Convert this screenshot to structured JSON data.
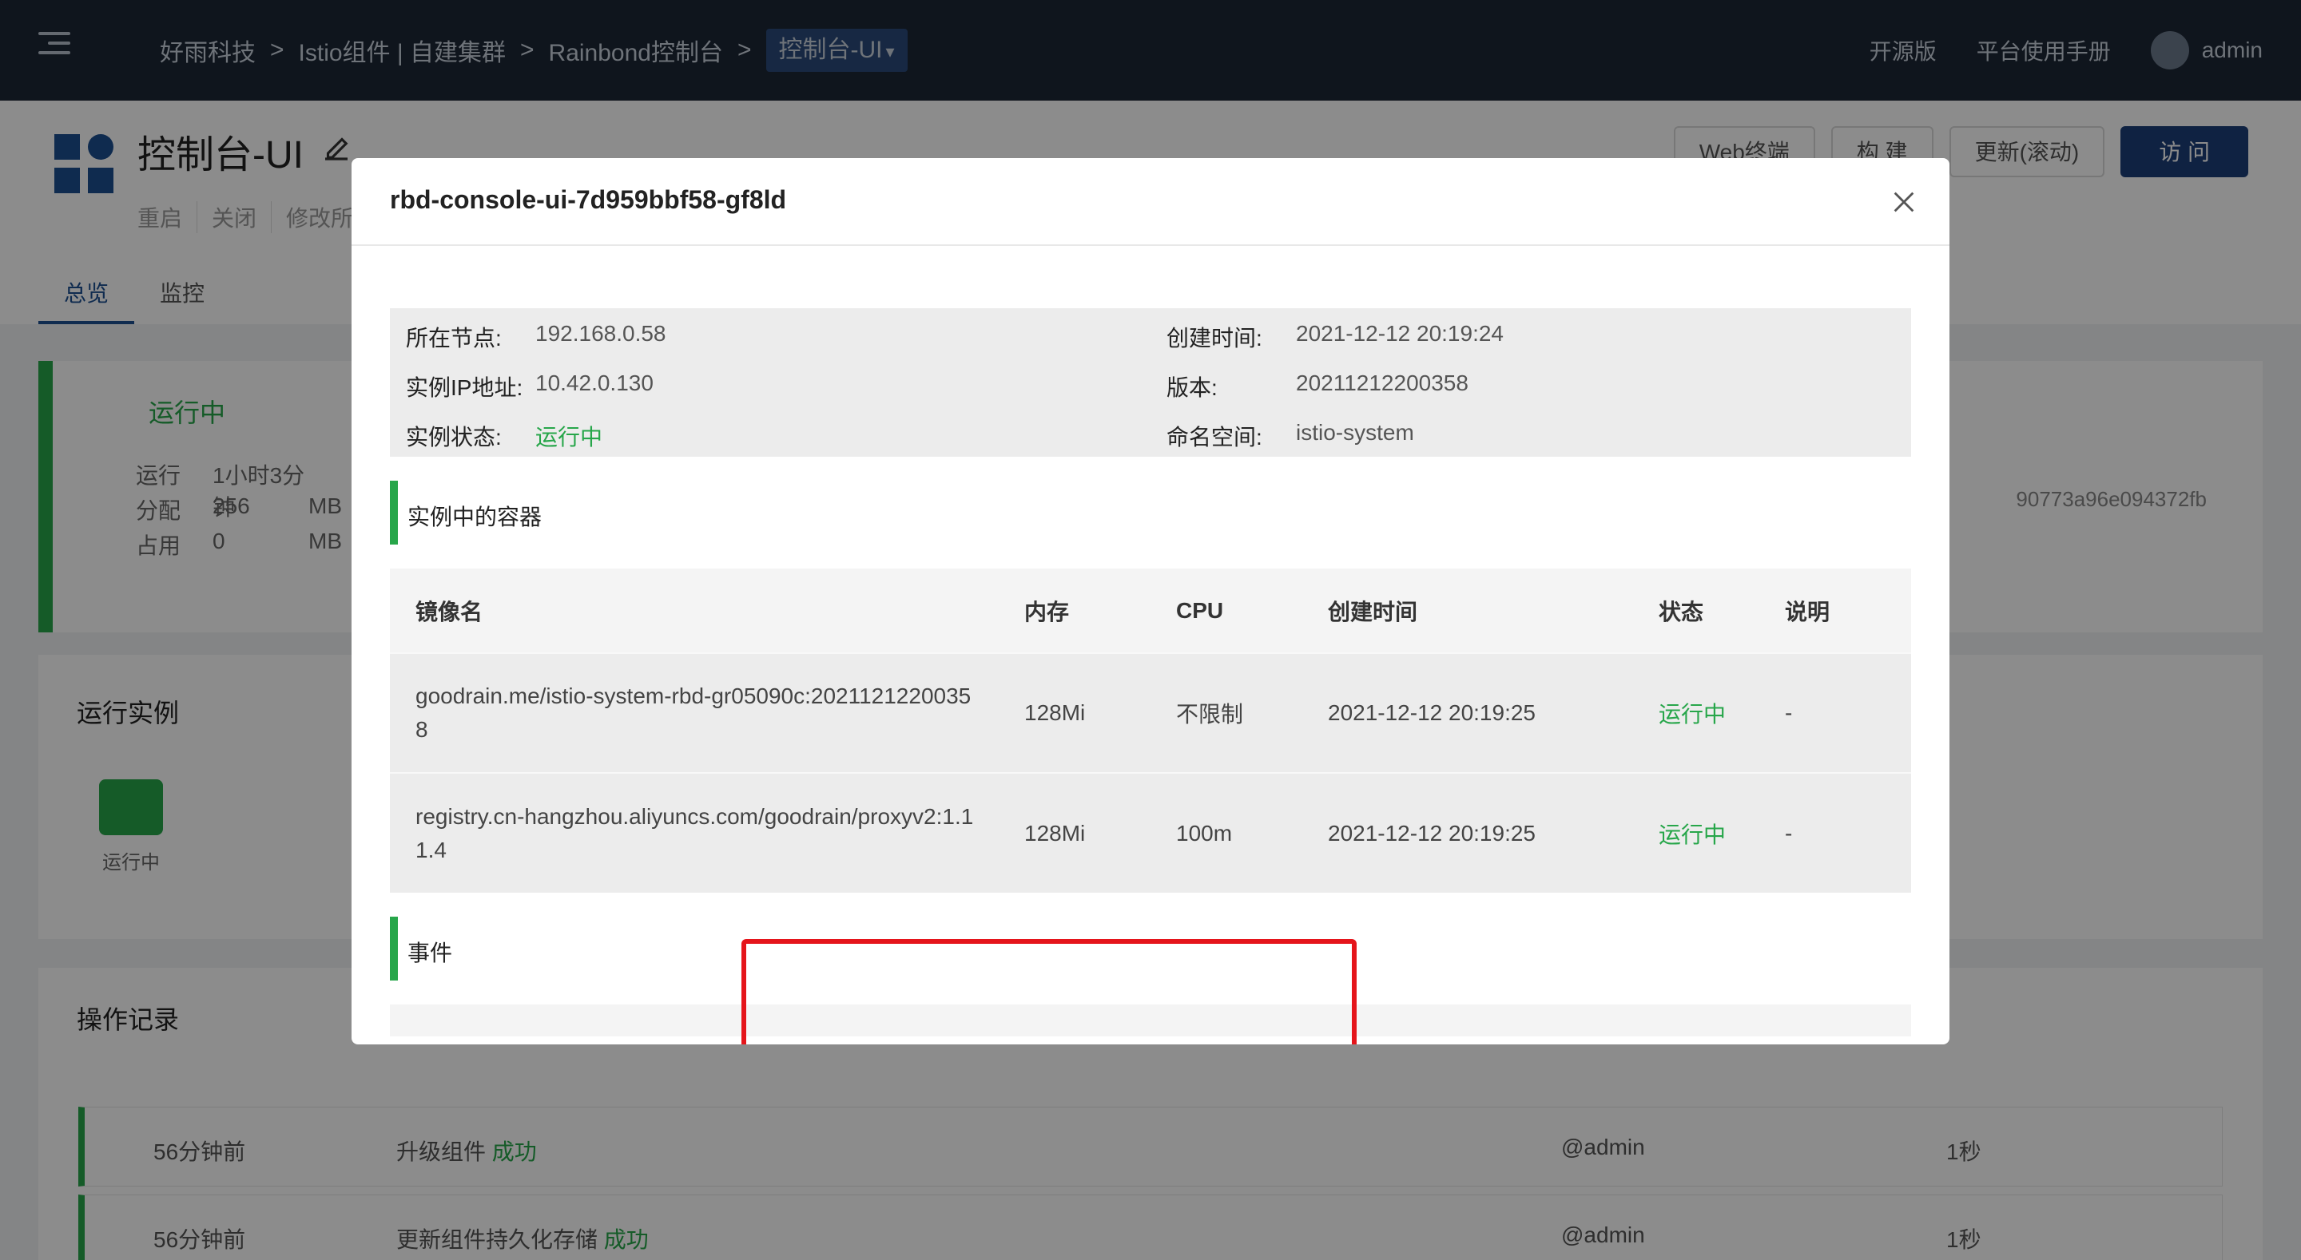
{
  "topbar": {
    "breadcrumbs": [
      "好雨科技",
      "Istio组件 | 自建集群",
      "Rainbond控制台"
    ],
    "separator": ">",
    "current": "控制台-UI",
    "links": [
      "开源版",
      "平台使用手册"
    ],
    "user": "admin"
  },
  "page": {
    "title": "控制台-UI",
    "actions": [
      "重启",
      "关闭",
      "修改所"
    ],
    "buttons": [
      "Web终端",
      "构 建",
      "更新(滚动)",
      "访 问"
    ],
    "tabs": [
      "总览",
      "监控"
    ]
  },
  "status": {
    "label": "运行中",
    "stats": [
      {
        "k": "运行",
        "v": "1小时3分钟",
        "u": ""
      },
      {
        "k": "分配",
        "v": "256",
        "u": "MB"
      },
      {
        "k": "占用",
        "v": "0",
        "u": "MB"
      }
    ],
    "hash": "90773a96e094372fb"
  },
  "instances": {
    "title": "运行实例",
    "state": "运行中"
  },
  "ops": {
    "title": "操作记录",
    "rows": [
      {
        "time": "56分钟前",
        "action": "升级组件",
        "result": "成功",
        "user": "@admin",
        "duration": "1秒"
      },
      {
        "time": "56分钟前",
        "action": "更新组件持久化存储",
        "result": "成功",
        "user": "@admin",
        "duration": "1秒"
      }
    ]
  },
  "modal": {
    "title": "rbd-console-ui-7d959bbf58-gf8ld",
    "info": {
      "node_k": "所在节点:",
      "node_v": "192.168.0.58",
      "created_k": "创建时间:",
      "created_v": "2021-12-12 20:19:24",
      "ip_k": "实例IP地址:",
      "ip_v": "10.42.0.130",
      "version_k": "版本:",
      "version_v": "20211212200358",
      "state_k": "实例状态:",
      "state_v": "运行中",
      "ns_k": "命名空间:",
      "ns_v": "istio-system"
    },
    "containers_title": "实例中的容器",
    "columns": [
      "镜像名",
      "内存",
      "CPU",
      "创建时间",
      "状态",
      "说明"
    ],
    "containers": [
      {
        "image": "goodrain.me/istio-system-rbd-gr05090c:20211212200358",
        "mem": "128Mi",
        "cpu": "不限制",
        "created": "2021-12-12 20:19:25",
        "state": "运行中",
        "desc": "-"
      },
      {
        "image": "registry.cn-hangzhou.aliyuncs.com/goodrain/proxyv2:1.11.4",
        "mem": "128Mi",
        "cpu": "100m",
        "created": "2021-12-12 20:19:25",
        "state": "运行中",
        "desc": "-"
      }
    ],
    "events_title": "事件"
  },
  "colors": {
    "accent_green": "#27a64a",
    "brand_blue": "#1d3f78",
    "highlight_red": "#e5151b"
  }
}
